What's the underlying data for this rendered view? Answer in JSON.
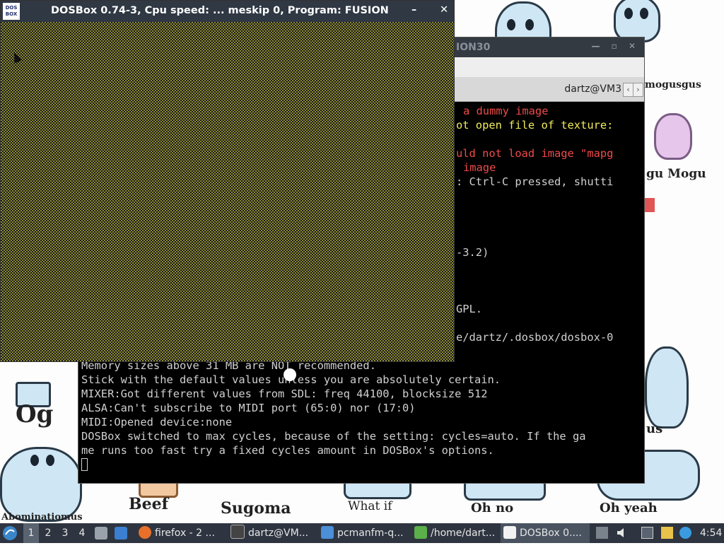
{
  "wallpaper": {
    "labels": [
      "mogusgus",
      "gu Mogu",
      "Og",
      "Beef",
      "Sugoma",
      "What if",
      "Oh no",
      "Oh yeah",
      "Abominatiomus",
      "us"
    ]
  },
  "terminal": {
    "title": "ION30",
    "tab_label": "dartz@VM3",
    "tab_prev": "‹",
    "tab_next": "›",
    "lines_right": [
      {
        "text": "a dummy image",
        "color": "red"
      },
      {
        "text": "ot open file of texture:",
        "color": "yellow"
      },
      {
        "text": "uld not load image \"mapg",
        "color": "red"
      },
      {
        "text": "image",
        "color": "red"
      },
      {
        "text": ": Ctrl-C pressed, shutti",
        "color": "white"
      },
      {
        "text": "-3.2)",
        "color": "white"
      },
      {
        "text": "GPL.",
        "color": "white"
      },
      {
        "text": "e/dartz/.dosbox/dosbox-0",
        "color": "white"
      }
    ],
    "lines_full": [
      "Memory sizes above 31 MB are NOT recommended.",
      "Stick with the default values unless you are absolutely certain.",
      "MIXER:Got different values from SDL: freq 44100, blocksize 512",
      "ALSA:Can't subscribe to MIDI port (65:0) nor (17:0)",
      "MIDI:Opened device:none",
      "DOSBox switched to max cycles, because of the setting: cycles=auto. If the ga",
      "me runs too fast try a fixed cycles amount in DOSBox's options."
    ]
  },
  "dosbox": {
    "logo": "DOS BOX",
    "title": "DOSBox 0.74-3, Cpu speed: ...  meskip  0, Program:   FUSION",
    "minimize": "–",
    "close": "✕"
  },
  "taskbar": {
    "workspaces": [
      "1",
      "2",
      "3",
      "4"
    ],
    "buttons": [
      {
        "label": "firefox - 2 ...",
        "icon": "firefox-icon"
      },
      {
        "label": "dartz@VM...",
        "icon": "terminal-icon"
      },
      {
        "label": "pcmanfm-q...",
        "icon": "folder-icon"
      },
      {
        "label": "/home/dart...",
        "icon": "file-manager-icon"
      },
      {
        "label": "DOSBox 0....",
        "icon": "dosbox-icon"
      }
    ],
    "clock": "4:54"
  }
}
